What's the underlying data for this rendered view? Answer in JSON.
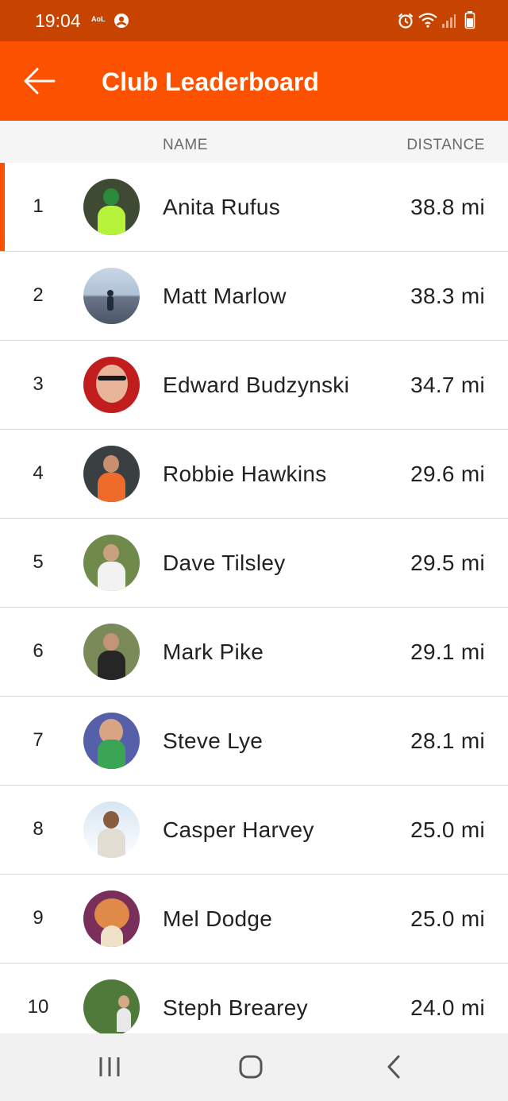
{
  "status_bar": {
    "time": "19:04",
    "carrier_badge": "AoL",
    "icons": [
      "account-circle-icon",
      "alarm-icon",
      "wifi-icon",
      "signal-icon",
      "battery-icon"
    ]
  },
  "app_bar": {
    "title": "Club Leaderboard",
    "back_icon": "arrow-left-icon",
    "accent_color": "#fc5200"
  },
  "columns": {
    "name": "NAME",
    "distance": "DISTANCE"
  },
  "leaderboard": [
    {
      "rank": "1",
      "name": "Anita Rufus",
      "distance": "38.8 mi",
      "highlight": true
    },
    {
      "rank": "2",
      "name": "Matt Marlow",
      "distance": "38.3 mi"
    },
    {
      "rank": "3",
      "name": "Edward Budzynski",
      "distance": "34.7 mi"
    },
    {
      "rank": "4",
      "name": "Robbie Hawkins",
      "distance": "29.6 mi"
    },
    {
      "rank": "5",
      "name": "Dave Tilsley",
      "distance": "29.5 mi"
    },
    {
      "rank": "6",
      "name": "Mark Pike",
      "distance": "29.1 mi"
    },
    {
      "rank": "7",
      "name": "Steve Lye",
      "distance": "28.1 mi"
    },
    {
      "rank": "8",
      "name": "Casper Harvey",
      "distance": "25.0 mi"
    },
    {
      "rank": "9",
      "name": "Mel Dodge",
      "distance": "25.0 mi"
    },
    {
      "rank": "10",
      "name": "Steph Brearey",
      "distance": "24.0 mi"
    }
  ],
  "nav_bar": {
    "icons": [
      "recent-apps-icon",
      "home-icon",
      "back-icon"
    ]
  }
}
